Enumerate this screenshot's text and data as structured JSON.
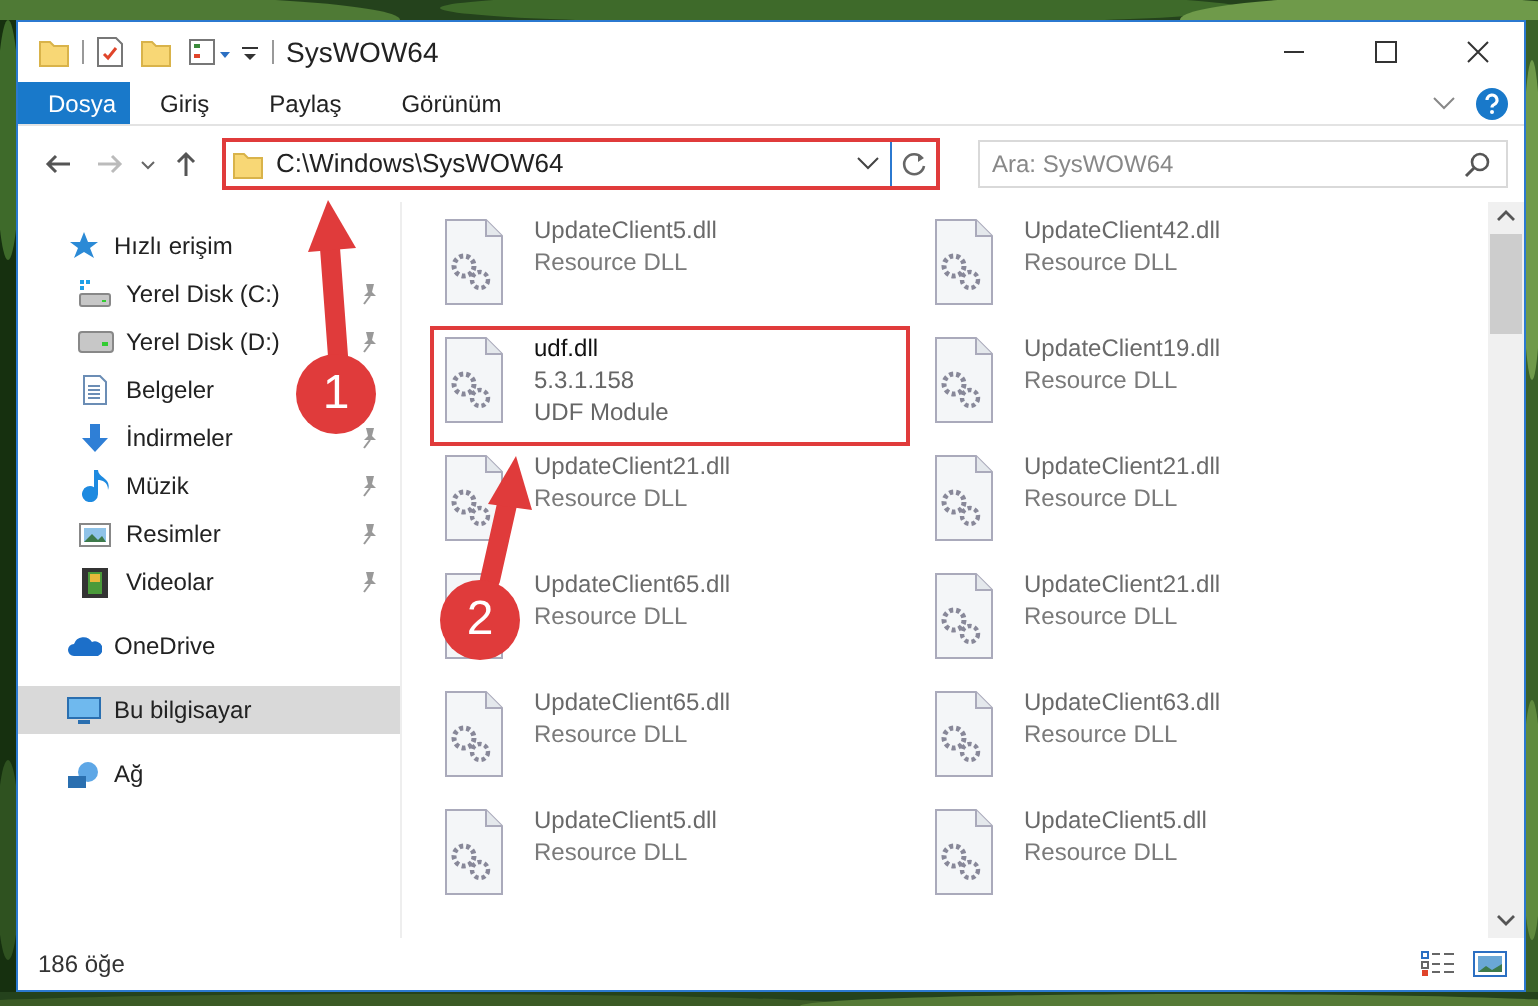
{
  "window": {
    "title": "SysWOW64"
  },
  "ribbon": {
    "tabs": [
      {
        "label": "Dosya",
        "selected": true
      },
      {
        "label": "Giriş",
        "selected": false
      },
      {
        "label": "Paylaş",
        "selected": false
      },
      {
        "label": "Görünüm",
        "selected": false
      }
    ]
  },
  "address_bar": {
    "path": "C:\\Windows\\SysWOW64",
    "highlighted": true
  },
  "search": {
    "placeholder": "Ara: SysWOW64"
  },
  "sidebar": {
    "items": [
      {
        "label": "Hızlı erişim",
        "kind": "quick",
        "selected": false,
        "children": [
          {
            "label": "Yerel Disk (C:)",
            "kind": "drive-c",
            "pinned": true,
            "selected": false
          },
          {
            "label": "Yerel Disk (D:)",
            "kind": "drive",
            "pinned": true,
            "selected": false
          },
          {
            "label": "Belgeler",
            "kind": "documents",
            "selected": false
          },
          {
            "label": "İndirmeler",
            "kind": "downloads",
            "pinned": true,
            "selected": false
          },
          {
            "label": "Müzik",
            "kind": "music",
            "pinned": true,
            "selected": false
          },
          {
            "label": "Resimler",
            "kind": "pictures",
            "pinned": true,
            "selected": false
          },
          {
            "label": "Videolar",
            "kind": "videos",
            "pinned": true,
            "selected": false
          }
        ]
      },
      {
        "label": "OneDrive",
        "kind": "cloud",
        "selected": false
      },
      {
        "label": "Bu bilgisayar",
        "kind": "computer",
        "selected": true
      },
      {
        "label": "Ağ",
        "kind": "network",
        "selected": false
      }
    ]
  },
  "files": [
    {
      "name": "UpdateClient5.dll",
      "details": [
        "Resource DLL"
      ],
      "blurred": true,
      "highlighted": false
    },
    {
      "name": "UpdateClient42.dll",
      "details": [
        "Resource DLL"
      ],
      "blurred": true,
      "highlighted": false
    },
    {
      "name": "udf.dll",
      "details": [
        "5.3.1.158",
        "UDF Module"
      ],
      "blurred": false,
      "highlighted": true
    },
    {
      "name": "UpdateClient19.dll",
      "details": [
        "Resource DLL"
      ],
      "blurred": true,
      "highlighted": false
    },
    {
      "name": "UpdateClient21.dll",
      "details": [
        "Resource DLL"
      ],
      "blurred": true,
      "highlighted": false
    },
    {
      "name": "UpdateClient21.dll",
      "details": [
        "Resource DLL"
      ],
      "blurred": true,
      "highlighted": false
    },
    {
      "name": "UpdateClient65.dll",
      "details": [
        "Resource DLL"
      ],
      "blurred": true,
      "highlighted": false
    },
    {
      "name": "UpdateClient21.dll",
      "details": [
        "Resource DLL"
      ],
      "blurred": true,
      "highlighted": false
    },
    {
      "name": "UpdateClient65.dll",
      "details": [
        "Resource DLL"
      ],
      "blurred": true,
      "highlighted": false
    },
    {
      "name": "UpdateClient63.dll",
      "details": [
        "Resource DLL"
      ],
      "blurred": true,
      "highlighted": false
    },
    {
      "name": "UpdateClient5.dll",
      "details": [
        "Resource DLL"
      ],
      "blurred": true,
      "highlighted": false
    },
    {
      "name": "UpdateClient5.dll",
      "details": [
        "Resource DLL"
      ],
      "blurred": true,
      "highlighted": false
    }
  ],
  "status_bar": {
    "item_count": "186 öğe"
  },
  "callouts": [
    {
      "number": "1"
    },
    {
      "number": "2"
    }
  ]
}
